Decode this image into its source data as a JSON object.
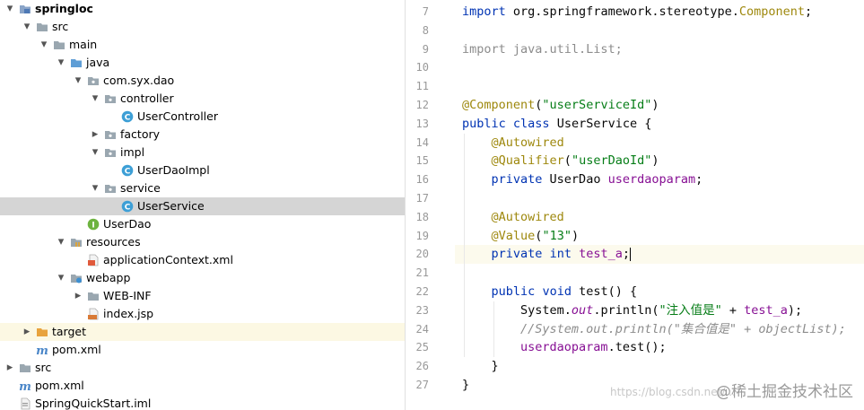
{
  "project_tree": {
    "items": [
      {
        "label": "springloc",
        "icon": "module-folder-icon",
        "expanded": true,
        "bold": true
      },
      {
        "label": "src",
        "icon": "folder-icon",
        "expanded": true
      },
      {
        "label": "main",
        "icon": "folder-icon",
        "expanded": true
      },
      {
        "label": "java",
        "icon": "source-folder-icon",
        "expanded": true
      },
      {
        "label": "com.syx.dao",
        "icon": "package-icon",
        "expanded": true
      },
      {
        "label": "controller",
        "icon": "package-icon",
        "expanded": true
      },
      {
        "label": "UserController",
        "icon": "class-icon"
      },
      {
        "label": "factory",
        "icon": "package-icon",
        "expanded": false
      },
      {
        "label": "impl",
        "icon": "package-icon",
        "expanded": true
      },
      {
        "label": "UserDaoImpl",
        "icon": "class-icon"
      },
      {
        "label": "service",
        "icon": "package-icon",
        "expanded": true
      },
      {
        "label": "UserService",
        "icon": "class-icon",
        "selected": true
      },
      {
        "label": "UserDao",
        "icon": "interface-icon"
      },
      {
        "label": "resources",
        "icon": "resources-folder-icon",
        "expanded": true
      },
      {
        "label": "applicationContext.xml",
        "icon": "xml-file-icon"
      },
      {
        "label": "webapp",
        "icon": "web-folder-icon",
        "expanded": true
      },
      {
        "label": "WEB-INF",
        "icon": "folder-icon",
        "expanded": false
      },
      {
        "label": "index.jsp",
        "icon": "jsp-file-icon"
      },
      {
        "label": "target",
        "icon": "excluded-folder-icon",
        "expanded": false
      },
      {
        "label": "pom.xml",
        "icon": "maven-file-icon"
      },
      {
        "label": "src",
        "icon": "folder-icon",
        "expanded": false
      },
      {
        "label": "pom.xml",
        "icon": "maven-file-icon"
      },
      {
        "label": "SpringQuickStart.iml",
        "icon": "iml-file-icon"
      }
    ]
  },
  "editor": {
    "current_line": "20",
    "lines": [
      {
        "num": "7",
        "text": "import org.springframework.stereotype.Component;"
      },
      {
        "num": "8",
        "text": ""
      },
      {
        "num": "9",
        "text": "import java.util.List;"
      },
      {
        "num": "10",
        "text": ""
      },
      {
        "num": "11",
        "text": ""
      },
      {
        "num": "12",
        "text": "@Component(\"userServiceId\")"
      },
      {
        "num": "13",
        "text": "public class UserService {"
      },
      {
        "num": "14",
        "text": "    @Autowired"
      },
      {
        "num": "15",
        "text": "    @Qualifier(\"userDaoId\")"
      },
      {
        "num": "16",
        "text": "    private UserDao userdaoparam;"
      },
      {
        "num": "17",
        "text": ""
      },
      {
        "num": "18",
        "text": "    @Autowired"
      },
      {
        "num": "19",
        "text": "    @Value(\"13\")"
      },
      {
        "num": "20",
        "text": "    private int test_a;"
      },
      {
        "num": "21",
        "text": ""
      },
      {
        "num": "22",
        "text": "    public void test() {"
      },
      {
        "num": "23",
        "text": "        System.out.println(\"注入值是\" + test_a);"
      },
      {
        "num": "24",
        "text": "        //System.out.println(\"集合值是\" + objectList);"
      },
      {
        "num": "25",
        "text": "        userdaoparam.test();"
      },
      {
        "num": "26",
        "text": "    }"
      },
      {
        "num": "27",
        "text": "}"
      }
    ]
  },
  "watermark": "@稀土掘金技术社区",
  "watermark_url": "https://blog.csdn.net/..."
}
